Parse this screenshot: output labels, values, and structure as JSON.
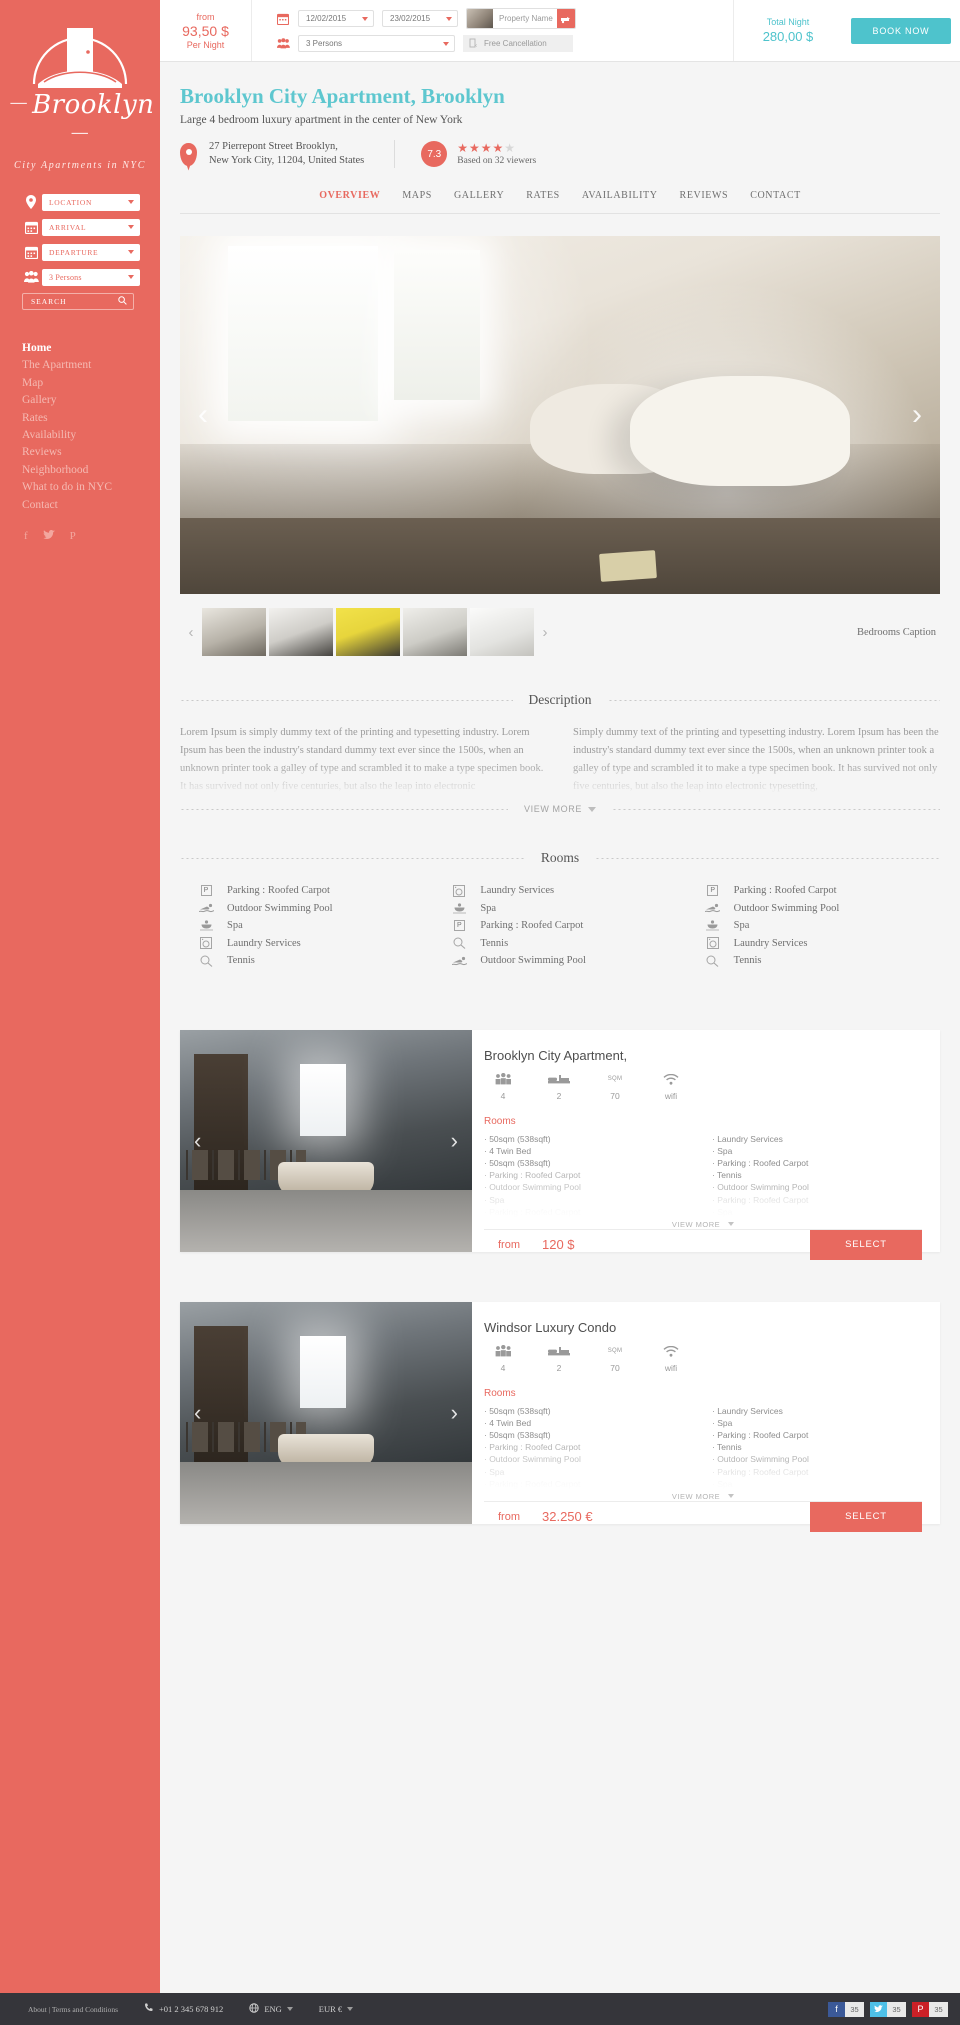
{
  "sidebar": {
    "brand": "Brooklyn",
    "tagline": "City Apartments in NYC",
    "fields": [
      {
        "icon": "map-pin-icon",
        "value": "LOCATION"
      },
      {
        "icon": "calendar-icon",
        "value": "ARRIVAL"
      },
      {
        "icon": "calendar-icon",
        "value": "DEPARTURE"
      },
      {
        "icon": "persons-icon",
        "value": "3 Persons"
      }
    ],
    "search_label": "SEARCH",
    "nav": [
      {
        "label": "Home",
        "active": true
      },
      {
        "label": "The Apartment",
        "active": false
      },
      {
        "label": "Map",
        "active": false
      },
      {
        "label": "Gallery",
        "active": false
      },
      {
        "label": "Rates",
        "active": false
      },
      {
        "label": "Availability",
        "active": false
      },
      {
        "label": "Reviews",
        "active": false
      },
      {
        "label": "Neighborhood",
        "active": false
      },
      {
        "label": "What to do in NYC",
        "active": false
      },
      {
        "label": "Contact",
        "active": false
      }
    ],
    "social": [
      "facebook-icon",
      "twitter-icon",
      "pinterest-icon"
    ]
  },
  "topbar": {
    "from_label": "from",
    "price": "93,50 $",
    "per_label": "Per Night",
    "arrival_date": "12/02/2015",
    "departure_date": "23/02/2015",
    "persons": "3 Persons",
    "property_placeholder": "Property Name",
    "cancellation": "Free Cancellation",
    "total_label": "Total Night",
    "total_value": "280,00 $",
    "book_label": "BOOK NOW"
  },
  "header": {
    "title": "Brooklyn City Apartment, Brooklyn",
    "subtitle": "Large 4 bedroom luxury apartment in the center of New York",
    "address_line1": "27 Pierrepont Street Brooklyn,",
    "address_line2": "New York City, 11204, United States",
    "score": "7.3",
    "stars_filled": 4,
    "stars_total": 5,
    "reviews": "Based on 32 viewers"
  },
  "tabs": [
    {
      "label": "OVERVIEW",
      "active": true
    },
    {
      "label": "MAPS",
      "active": false
    },
    {
      "label": "GALLERY",
      "active": false
    },
    {
      "label": "RATES",
      "active": false
    },
    {
      "label": "AVAILABILITY",
      "active": false
    },
    {
      "label": "REVIEWS",
      "active": false
    },
    {
      "label": "CONTACT",
      "active": false
    }
  ],
  "gallery": {
    "prev": "‹",
    "next": "›",
    "caption": "Bedrooms Caption",
    "thumb_prev": "‹",
    "thumb_next": "›"
  },
  "description": {
    "title": "Description",
    "view_more": "VIEW MORE",
    "col1": "Lorem Ipsum is simply dummy text of the printing and typesetting industry. Lorem Ipsum has been the industry's standard dummy text ever since the 1500s, when an unknown printer took a galley of type and scrambled it to make a type specimen book. It has survived not only five centuries, but also the leap into electronic",
    "col2": "Simply dummy text of the printing and typesetting industry. Lorem Ipsum has been the industry's standard dummy text ever since the 1500s, when an unknown printer took a galley of type and scrambled it to make a type specimen book. It has survived not only five centuries, but also the leap into electronic typesetting,"
  },
  "rooms_section": {
    "title": "Rooms",
    "columns": [
      [
        {
          "icon": "parking-icon",
          "label": "Parking : Roofed Carpot"
        },
        {
          "icon": "swimming-icon",
          "label": "Outdoor Swimming Pool"
        },
        {
          "icon": "spa-icon",
          "label": "Spa"
        },
        {
          "icon": "laundry-icon",
          "label": "Laundry Services"
        },
        {
          "icon": "tennis-icon",
          "label": "Tennis"
        }
      ],
      [
        {
          "icon": "laundry-icon",
          "label": "Laundry Services"
        },
        {
          "icon": "spa-icon",
          "label": "Spa"
        },
        {
          "icon": "parking-icon",
          "label": "Parking : Roofed Carpot"
        },
        {
          "icon": "tennis-icon",
          "label": "Tennis"
        },
        {
          "icon": "swimming-icon",
          "label": "Outdoor Swimming Pool"
        }
      ],
      [
        {
          "icon": "parking-icon",
          "label": "Parking : Roofed Carpot"
        },
        {
          "icon": "swimming-icon",
          "label": "Outdoor Swimming Pool"
        },
        {
          "icon": "spa-icon",
          "label": "Spa"
        },
        {
          "icon": "laundry-icon",
          "label": "Laundry Services"
        },
        {
          "icon": "tennis-icon",
          "label": "Tennis"
        }
      ]
    ]
  },
  "property_cards": [
    {
      "title": "Brooklyn City Apartment,",
      "specs": [
        {
          "icon": "persons-icon",
          "label": "",
          "value": "4"
        },
        {
          "icon": "bed-icon",
          "label": "",
          "value": "2"
        },
        {
          "icon": "area-icon",
          "label": "SQM",
          "value": "70"
        },
        {
          "icon": "wifi-icon",
          "label": "",
          "value": "wifi"
        }
      ],
      "rooms_label": "Rooms",
      "list_left": [
        "· 50sqm (538sqft)",
        "· 4 Twin Bed",
        "· 50sqm (538sqft)",
        "· Parking : Roofed Carpot",
        "· Outdoor Swimming Pool",
        "· Spa",
        "· Parking : Roofed Carpot"
      ],
      "list_right": [
        "· Laundry Services",
        "· Spa",
        "· Parking : Roofed Carpot",
        "· Tennis",
        "· Outdoor Swimming Pool",
        "· Parking : Roofed Carpot",
        "· Spa"
      ],
      "view_more": "VIEW MORE",
      "from_label": "from",
      "price": "120 $",
      "select_label": "SELECT",
      "prev": "‹",
      "next": "›"
    },
    {
      "title": "Windsor Luxury Condo",
      "specs": [
        {
          "icon": "persons-icon",
          "label": "",
          "value": "4"
        },
        {
          "icon": "bed-icon",
          "label": "",
          "value": "2"
        },
        {
          "icon": "area-icon",
          "label": "SQM",
          "value": "70"
        },
        {
          "icon": "wifi-icon",
          "label": "",
          "value": "wifi"
        }
      ],
      "rooms_label": "Rooms",
      "list_left": [
        "· 50sqm (538sqft)",
        "· 4 Twin Bed",
        "· 50sqm (538sqft)",
        "· Parking : Roofed Carpot",
        "· Outdoor Swimming Pool",
        "· Spa",
        "· Parking : Roofed Carpot"
      ],
      "list_right": [
        "· Laundry Services",
        "· Spa",
        "· Parking : Roofed Carpot",
        "· Tennis",
        "· Outdoor Swimming Pool",
        "· Parking : Roofed Carpot",
        "· Spa"
      ],
      "view_more": "VIEW MORE",
      "from_label": "from",
      "price": "32.250 €",
      "select_label": "SELECT",
      "prev": "‹",
      "next": "›"
    }
  ],
  "footer": {
    "about": "About  |  Terms and Conditions",
    "phone": "+01 2 345 678 912",
    "lang": "ENG",
    "currency": "EUR €",
    "social": [
      {
        "name": "facebook",
        "glyph": "f",
        "count": "35"
      },
      {
        "name": "twitter",
        "glyph": "t",
        "count": "35"
      },
      {
        "name": "pinterest",
        "glyph": "P",
        "count": "35"
      }
    ]
  },
  "colors": {
    "brand_red": "#e8695f",
    "teal": "#4ec3cc",
    "title_teal": "#5ec7cf",
    "footer_dark": "#35353a"
  }
}
